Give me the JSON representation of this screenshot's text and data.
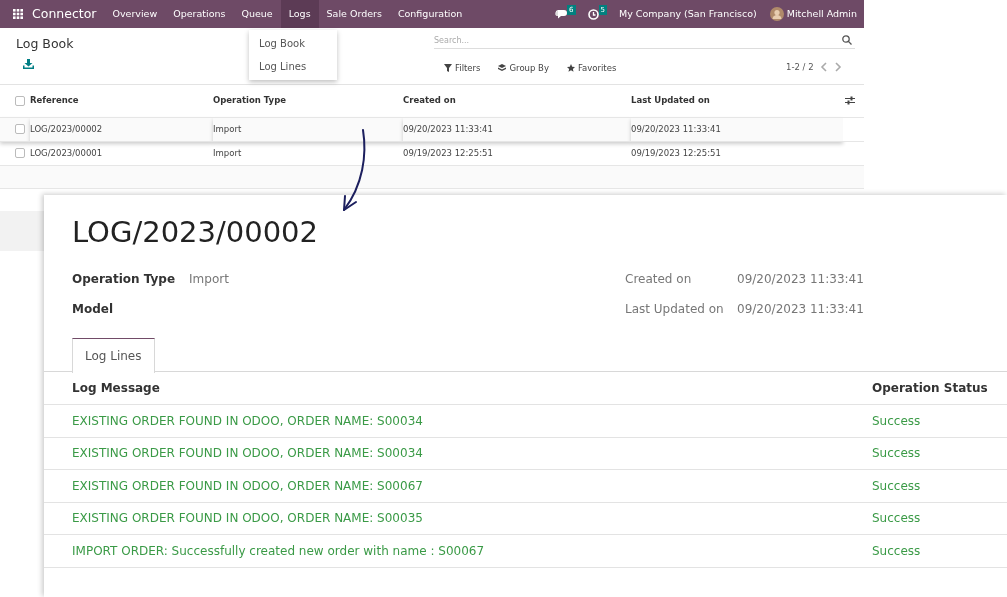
{
  "navbar": {
    "app_name": "Connector",
    "menu": [
      {
        "label": "Overview",
        "selected": false
      },
      {
        "label": "Operations",
        "selected": false
      },
      {
        "label": "Queue",
        "selected": false
      },
      {
        "label": "Logs",
        "selected": true
      },
      {
        "label": "Sale Orders",
        "selected": false
      },
      {
        "label": "Configuration",
        "selected": false
      }
    ],
    "messages_count": "6",
    "activities_count": "5",
    "company": "My Company (San Francisco)",
    "user": "Mitchell Admin"
  },
  "logs_dropdown": {
    "items": [
      "Log Book",
      "Log Lines"
    ]
  },
  "control_panel": {
    "title": "Log Book",
    "search": {
      "placeholder": "Search..."
    },
    "filters": "Filters",
    "group_by": "Group By",
    "favorites": "Favorites",
    "pager": "1-2 / 2"
  },
  "list": {
    "columns": [
      "Reference",
      "Operation Type",
      "Created on",
      "Last Updated on"
    ],
    "header_checked": false,
    "rows": [
      {
        "reference": "LOG/2023/00002",
        "operation_type": "Import",
        "created_on": "09/20/2023 11:33:41",
        "last_updated_on": "09/20/2023 11:33:41",
        "checked": false,
        "highlighted": true
      },
      {
        "reference": "LOG/2023/00001",
        "operation_type": "Import",
        "created_on": "09/19/2023 12:25:51",
        "last_updated_on": "09/19/2023 12:25:51",
        "checked": false,
        "highlighted": false
      }
    ]
  },
  "form": {
    "title": "LOG/2023/00002",
    "left_fields": [
      {
        "label": "Operation Type",
        "value": "Import"
      },
      {
        "label": "Model"
      }
    ],
    "right_fields": [
      {
        "label": "Created on",
        "value": "09/20/2023 11:33:41"
      },
      {
        "label": "Last Updated on",
        "value": "09/20/2023 11:33:41"
      }
    ],
    "tabs": [
      {
        "label": "Log Lines",
        "selected": true
      }
    ],
    "lines": {
      "columns": [
        "Log Message",
        "Operation Status"
      ],
      "rows": [
        {
          "message": "EXISTING ORDER FOUND IN ODOO, ORDER NAME: S00034",
          "status": "Success"
        },
        {
          "message": "EXISTING ORDER FOUND IN ODOO, ORDER NAME: S00034",
          "status": "Success"
        },
        {
          "message": "EXISTING ORDER FOUND IN ODOO, ORDER NAME: S00067",
          "status": "Success"
        },
        {
          "message": "EXISTING ORDER FOUND IN ODOO, ORDER NAME: S00035",
          "status": "Success"
        },
        {
          "message": "IMPORT ORDER: Successfully created new order with name : S00067",
          "status": "Success"
        }
      ]
    }
  }
}
